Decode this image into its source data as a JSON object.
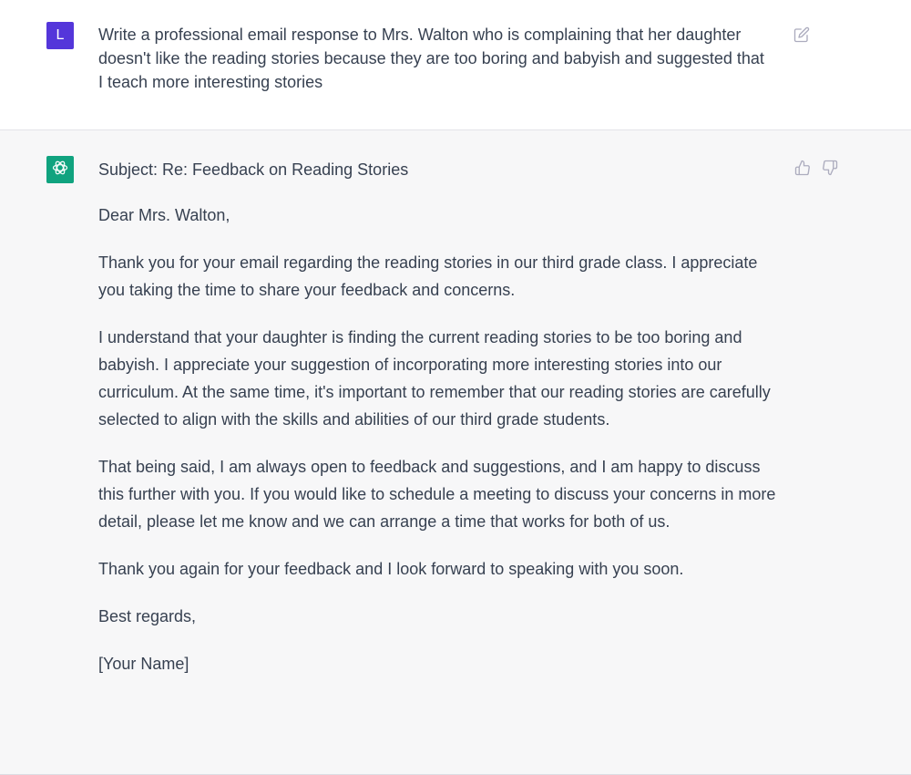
{
  "user_message": {
    "avatar_initial": "L",
    "text": "Write a professional email response to Mrs. Walton who is complaining that her daughter doesn't like the reading stories because they are too boring and babyish and suggested that I teach more interesting stories",
    "edit_icon": "edit-pencil-icon"
  },
  "assistant_message": {
    "avatar_icon": "openai-logo-icon",
    "paragraphs": [
      "Subject: Re: Feedback on Reading Stories",
      "Dear Mrs. Walton,",
      "Thank you for your email regarding the reading stories in our third grade class. I appreciate you taking the time to share your feedback and concerns.",
      "I understand that your daughter is finding the current reading stories to be too boring and babyish. I appreciate your suggestion of incorporating more interesting stories into our curriculum. At the same time, it's important to remember that our reading stories are carefully selected to align with the skills and abilities of our third grade students.",
      "That being said, I am always open to feedback and suggestions, and I am happy to discuss this further with you. If you would like to schedule a meeting to discuss your concerns in more detail, please let me know and we can arrange a time that works for both of us.",
      "Thank you again for your feedback and I look forward to speaking with you soon.",
      "Best regards,",
      "[Your Name]"
    ],
    "thumbs_up_icon": "thumbs-up-icon",
    "thumbs_down_icon": "thumbs-down-icon"
  },
  "colors": {
    "user_avatar_bg": "#5436da",
    "bot_avatar_bg": "#10a37f",
    "assistant_bg": "#f7f7f8",
    "text": "#374151",
    "icon": "#acacbe"
  }
}
